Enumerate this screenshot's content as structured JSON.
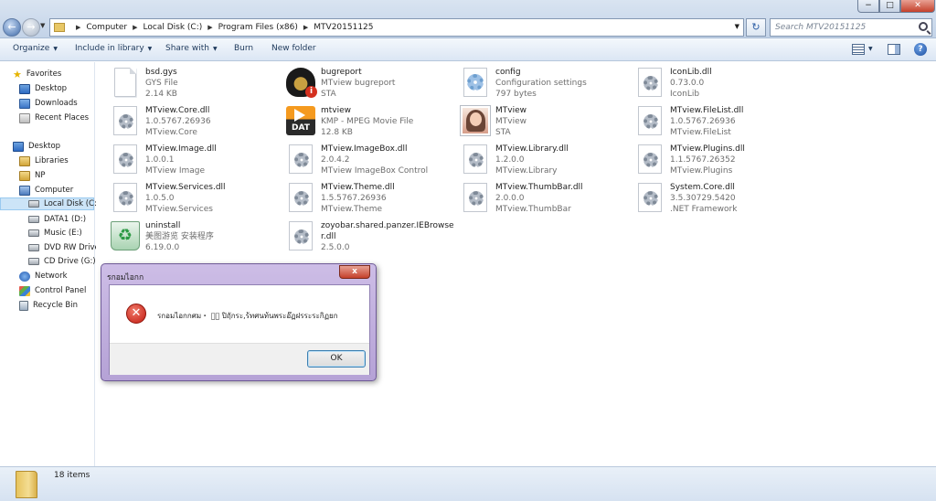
{
  "address_bar": {
    "crumbs": [
      "Computer",
      "Local Disk (C:)",
      "Program Files (x86)",
      "MTV20151125"
    ],
    "search_placeholder": "Search MTV20151125"
  },
  "toolbar": {
    "organize": "Organize",
    "include_in_library": "Include in library",
    "share_with": "Share with",
    "burn": "Burn",
    "new_folder": "New folder",
    "help": "?"
  },
  "nav_pane": {
    "favorites": "Favorites",
    "desktop_fav": "Desktop",
    "downloads": "Downloads",
    "recent_places": "Recent Places",
    "desktop": "Desktop",
    "libraries": "Libraries",
    "np": "NP",
    "computer": "Computer",
    "local_disk": "Local Disk (C:)",
    "data1": "DATA1 (D:)",
    "music": "Music (E:)",
    "dvd": "DVD RW Drive",
    "cd": "CD Drive (G:)",
    "network": "Network",
    "control_panel": "Control Panel",
    "recycle_bin": "Recycle Bin"
  },
  "files": [
    {
      "name": "bsd.gys",
      "line2": "GYS File",
      "line3": "2.14 KB",
      "icon": "generic-file-icon"
    },
    {
      "name": "bugreport",
      "line2": "MTview bugreport",
      "line3": "STA",
      "icon": "bug-icon"
    },
    {
      "name": "config",
      "line2": "Configuration settings",
      "line3": "797 bytes",
      "icon": "config-file-icon"
    },
    {
      "name": "IconLib.dll",
      "line2": "0.73.0.0",
      "line3": "IconLib",
      "icon": "dll-icon"
    },
    {
      "name": "MTview.Core.dll",
      "line2": "1.0.5767.26936",
      "line3": "MTview.Core",
      "icon": "dll-icon"
    },
    {
      "name": "mtview",
      "line2": "KMP - MPEG Movie File",
      "line3": "12.8 KB",
      "icon": "dat-icon"
    },
    {
      "name": "MTview",
      "line2": "MTview",
      "line3": "STA",
      "icon": "photo-icon"
    },
    {
      "name": "MTview.FileList.dll",
      "line2": "1.0.5767.26936",
      "line3": "MTview.FileList",
      "icon": "dll-icon"
    },
    {
      "name": "MTview.Image.dll",
      "line2": "1.0.0.1",
      "line3": "MTview Image",
      "icon": "dll-icon"
    },
    {
      "name": "MTview.ImageBox.dll",
      "line2": "2.0.4.2",
      "line3": "MTview ImageBox Control",
      "icon": "dll-icon"
    },
    {
      "name": "MTview.Library.dll",
      "line2": "1.2.0.0",
      "line3": "MTview.Library",
      "icon": "dll-icon"
    },
    {
      "name": "MTview.Plugins.dll",
      "line2": "1.1.5767.26352",
      "line3": "MTview.Plugins",
      "icon": "dll-icon"
    },
    {
      "name": "MTview.Services.dll",
      "line2": "1.0.5.0",
      "line3": "MTview.Services",
      "icon": "dll-icon"
    },
    {
      "name": "MTview.Theme.dll",
      "line2": "1.5.5767.26936",
      "line3": "MTview.Theme",
      "icon": "dll-icon"
    },
    {
      "name": "MTview.ThumbBar.dll",
      "line2": "2.0.0.0",
      "line3": "MTview.ThumbBar",
      "icon": "dll-icon"
    },
    {
      "name": "System.Core.dll",
      "line2": "3.5.30729.5420",
      "line3": ".NET Framework",
      "icon": "dll-icon"
    },
    {
      "name": "uninstall",
      "line2": "美图游览 安装程序",
      "line3": "6.19.0.0",
      "icon": "recycle-icon"
    },
    {
      "name": "zoyobar.shared.panzer.IEBrowser.dll",
      "line2": "2.5.0.0",
      "line3": "",
      "icon": "dll-icon"
    }
  ],
  "status": {
    "item_count": "18 items"
  },
  "dialog": {
    "title": "รกอมไอกก",
    "message": "รกอมไอกกศม・ บ゚ ปิฤักระ,ร้ทศนท้นพระอ๊ฏฝรระระกิฏยก",
    "ok": "OK",
    "close": "x"
  },
  "colors": {
    "explorer_chrome": "#c3d3e8",
    "dialog_frame": "#b5a2d6",
    "close_red": "#c4402b",
    "error_red": "#c21a10"
  }
}
